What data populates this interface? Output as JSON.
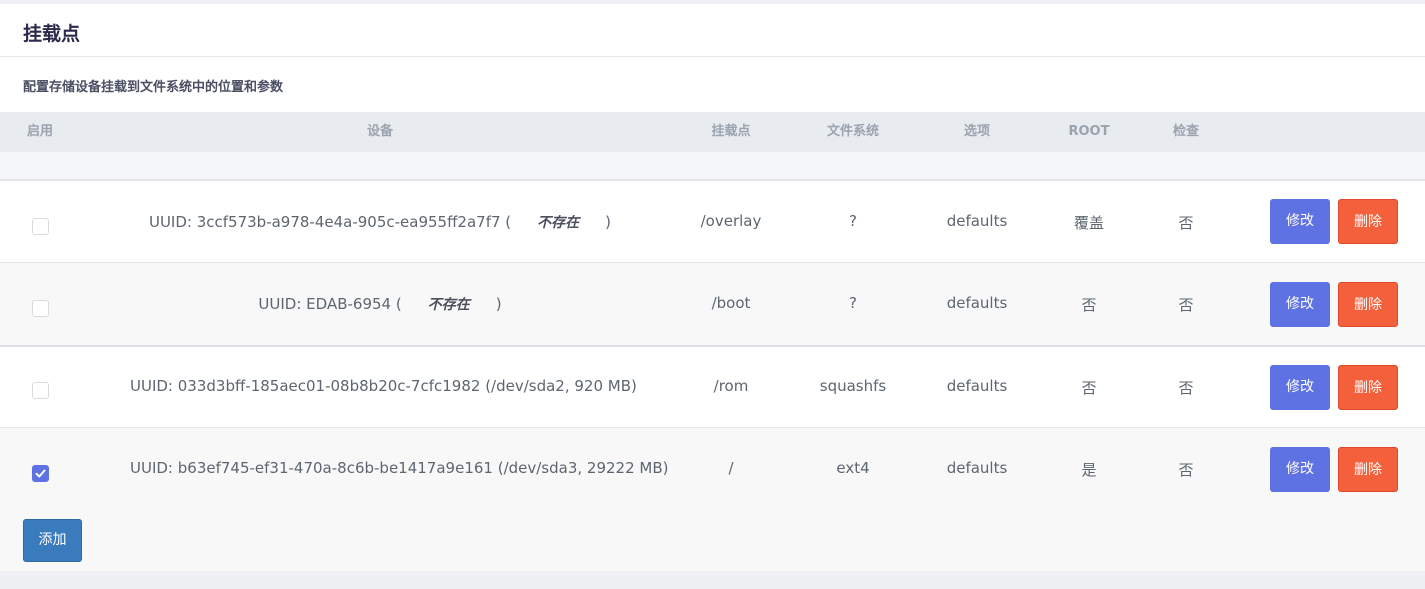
{
  "section": {
    "title": "挂载点",
    "description": "配置存储设备挂载到文件系统中的位置和参数"
  },
  "table": {
    "headers": {
      "enabled": "启用",
      "device": "设备",
      "mountpoint": "挂载点",
      "filesystem": "文件系统",
      "options": "选项",
      "root": "ROOT",
      "check": "检查"
    },
    "rows": [
      {
        "enabled": false,
        "device": "UUID: 3ccf573b-a978-4e4a-905c-ea955ff2a7f7 (",
        "device_missing": "不存在",
        "device_close": ")",
        "mountpoint": "/overlay",
        "filesystem": "?",
        "options": "defaults",
        "root": "覆盖",
        "check": "否"
      },
      {
        "enabled": false,
        "device": "UUID: EDAB-6954 (",
        "device_missing": "不存在",
        "device_close": ")",
        "mountpoint": "/boot",
        "filesystem": "?",
        "options": "defaults",
        "root": "否",
        "check": "否"
      },
      {
        "enabled": false,
        "device": "UUID: 033d3bff-185aec01-08b8b20c-7cfc1982 (/dev/sda2, 920 MB)",
        "mountpoint": "/rom",
        "filesystem": "squashfs",
        "options": "defaults",
        "root": "否",
        "check": "否"
      },
      {
        "enabled": true,
        "device": "UUID: b63ef745-ef31-470a-8c6b-be1417a9e161 (/dev/sda3, 29222 MB)",
        "mountpoint": "/",
        "filesystem": "ext4",
        "options": "defaults",
        "root": "是",
        "check": "否"
      }
    ],
    "edit_label": "修改",
    "delete_label": "删除"
  },
  "add_button": "添加",
  "colors": {
    "edit": "#5e72e4",
    "delete": "#f5603c",
    "add": "#3a7bbd",
    "checkbox_on": "#5e72e4"
  }
}
